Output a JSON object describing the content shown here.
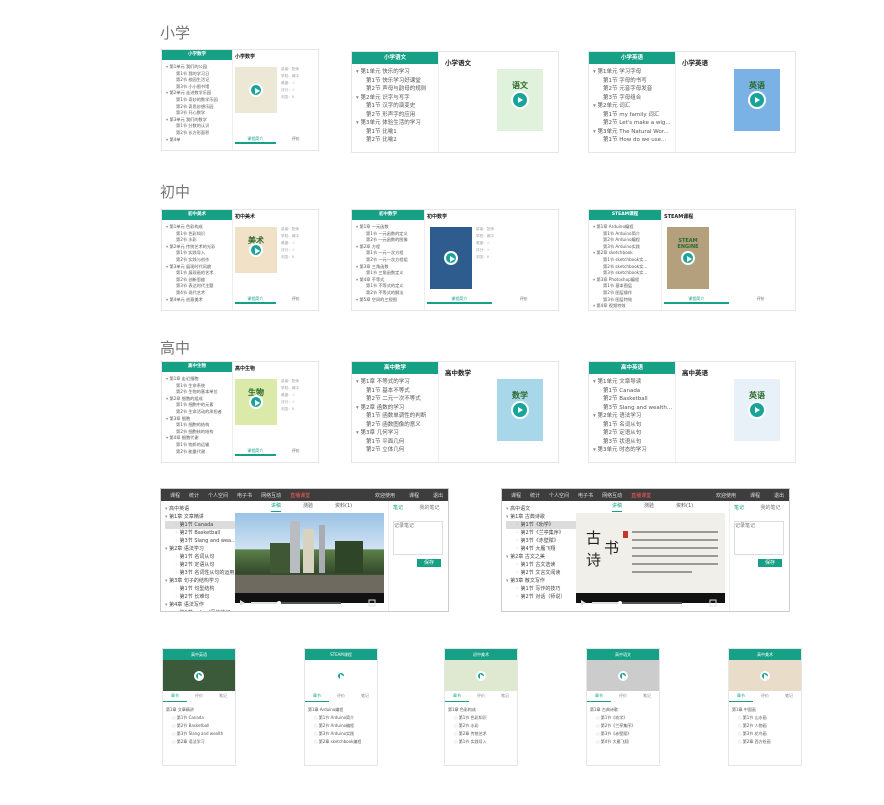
{
  "sections": {
    "primary": "小学",
    "middle": "初中",
    "high": "高中"
  },
  "cards": [
    {
      "title": "小学数学",
      "items": [
        {
          "t": "第1单元 我们的公园",
          "c": 1
        },
        {
          "t": "第1节 我的学习日",
          "s": 1
        },
        {
          "t": "第2节 校园生活记",
          "s": 1
        },
        {
          "t": "第3节 小小图书馆",
          "s": 1
        },
        {
          "t": "第2单元 走进数学乐园",
          "c": 1
        },
        {
          "t": "第1节 奇妙的数学乐园",
          "s": 1
        },
        {
          "t": "第2节 奇思妙想乐园",
          "s": 1
        },
        {
          "t": "第3节 开心数学",
          "s": 1
        },
        {
          "t": "第3单元 我们的数学",
          "c": 1
        },
        {
          "t": "第1节 分数的认识",
          "s": 1
        },
        {
          "t": "第2节 长方形面积",
          "s": 1
        },
        {
          "t": "第4单",
          "c": 1
        }
      ],
      "meta": [
        "讲者：张师",
        "学校：城中",
        "难度：☆",
        "评分：☆",
        "浏览：0"
      ],
      "tabs": [
        "课程简介",
        "评价"
      ],
      "cover": "#ede7d6",
      "coverText": ""
    },
    {
      "title": "小学语文",
      "items": [
        {
          "t": "第1单元 快乐的学习",
          "c": 1
        },
        {
          "t": "第1节 快乐学习好课堂",
          "s": 1
        },
        {
          "t": "第2节 声母与韵母的规则",
          "s": 1
        },
        {
          "t": "第2单元 识字与写字",
          "c": 1
        },
        {
          "t": "第1节 汉字的演变史",
          "s": 1
        },
        {
          "t": "第2节 形声字的应用",
          "s": 1
        },
        {
          "t": "第3单元 体验生活的学习",
          "c": 1
        },
        {
          "t": "第1节 比喻1",
          "s": 1
        },
        {
          "t": "第2节 比喻2",
          "s": 1
        }
      ],
      "meta": [],
      "tabs": [],
      "cover": "#e0f1dc",
      "coverText": "语文"
    },
    {
      "title": "小学英语",
      "items": [
        {
          "t": "第1单元 学习字母",
          "c": 1
        },
        {
          "t": "第1节 字母的书写",
          "s": 1
        },
        {
          "t": "第2节 元音字母发音",
          "s": 1
        },
        {
          "t": "第3节 字母组合",
          "s": 1
        },
        {
          "t": "第2单元 词汇",
          "c": 1
        },
        {
          "t": "第1节 my family 词汇",
          "s": 1
        },
        {
          "t": "第2节 Let's make a wig...",
          "s": 1
        },
        {
          "t": "第3单元 The Natural Wor...",
          "c": 1
        },
        {
          "t": "第1节 How do we use...",
          "s": 1
        }
      ],
      "meta": [],
      "tabs": [],
      "cover": "#7bb2e6",
      "coverText": "英语"
    },
    {
      "title": "初中美术",
      "items": [
        {
          "t": "第1单元 色彩构成",
          "c": 1
        },
        {
          "t": "第1节 色彩知识",
          "s": 1
        },
        {
          "t": "第2节 水彩",
          "s": 1
        },
        {
          "t": "第2单元 传统艺术的光彩",
          "c": 1
        },
        {
          "t": "第1节 实践导入",
          "s": 1
        },
        {
          "t": "第2节 实践与创作",
          "s": 1
        },
        {
          "t": "第3单元 展现时代风貌",
          "c": 1
        },
        {
          "t": "第1节 展现画的艺术",
          "s": 1
        },
        {
          "t": "第2节 创新思维",
          "s": 1
        },
        {
          "t": "第3节 表达时代主题",
          "s": 1
        },
        {
          "t": "第4节 现代艺术",
          "s": 1
        },
        {
          "t": "第4单元 创意美术",
          "c": 1
        }
      ],
      "meta": [
        "讲者：张师",
        "学校：城中",
        "难度：☆",
        "评分：☆",
        "浏览：0"
      ],
      "tabs": [
        "课程简介",
        "评价"
      ],
      "cover": "#f0e1c7",
      "coverText": "美术"
    },
    {
      "title": "初中数学",
      "items": [
        {
          "t": "第1章 一元函数",
          "c": 1
        },
        {
          "t": "第1节 一元函数的定义",
          "s": 1
        },
        {
          "t": "第2节 一元函数的图像",
          "s": 1
        },
        {
          "t": "第2章 方程",
          "c": 1
        },
        {
          "t": "第1节 一元一次方程",
          "s": 1
        },
        {
          "t": "第2节 一元一次方程组",
          "s": 1
        },
        {
          "t": "第3章 三角函数",
          "c": 1
        },
        {
          "t": "第1节 三角函数定义",
          "s": 1
        },
        {
          "t": "第4章 不等式",
          "c": 1
        },
        {
          "t": "第1节 不等式的定义",
          "s": 1
        },
        {
          "t": "第2节 不等式的解法",
          "s": 1
        },
        {
          "t": "第5章 空间的三视图",
          "c": 1
        }
      ],
      "meta": [
        "讲者：张师",
        "学校：城中",
        "难度：☆",
        "评分：☆",
        "浏览：0"
      ],
      "tabs": [
        "课程简介",
        "评价"
      ],
      "cover": "#2f5c8f",
      "coverText": ""
    },
    {
      "title": "STEAM课程",
      "items": [
        {
          "t": "第1章 Arduino编程",
          "c": 1
        },
        {
          "t": "第1节 Arduino简介",
          "s": 1
        },
        {
          "t": "第2节 Arduino编程",
          "s": 1
        },
        {
          "t": "第3节 Arduino实践",
          "s": 1
        },
        {
          "t": "第2章 sketchbook",
          "c": 1
        },
        {
          "t": "第1节 sketchbook实...",
          "s": 1
        },
        {
          "t": "第2节 sketchbook实...",
          "s": 1
        },
        {
          "t": "第3节 sketchbook实...",
          "s": 1
        },
        {
          "t": "第3章 Photoshop编程",
          "c": 1
        },
        {
          "t": "第1节 基本图层",
          "s": 1
        },
        {
          "t": "第2节 图层操作",
          "s": 1
        },
        {
          "t": "第3节 图层特效",
          "s": 1
        },
        {
          "t": "第4章 视频特效",
          "c": 1
        }
      ],
      "meta": [],
      "tabs": [
        "课程简介",
        "评价"
      ],
      "cover": "#b4a07c",
      "coverText": "STEAM ENGINE"
    },
    {
      "title": "高中生物",
      "items": [
        {
          "t": "第1章 走近细胞",
          "c": 1
        },
        {
          "t": "第1节 生命系统",
          "s": 1
        },
        {
          "t": "第2节 生物的基本单位",
          "s": 1
        },
        {
          "t": "第2章 细胞的组成",
          "c": 1
        },
        {
          "t": "第1节 细胞中的元素",
          "s": 1
        },
        {
          "t": "第2节 生命活动的承担者",
          "s": 1
        },
        {
          "t": "第3章 细胞",
          "c": 1
        },
        {
          "t": "第1节 细胞的结构",
          "s": 1
        },
        {
          "t": "第2节 细胞核的结构",
          "s": 1
        },
        {
          "t": "第4章 细胞代谢",
          "c": 1
        },
        {
          "t": "第1节 物质的运输",
          "s": 1
        },
        {
          "t": "第2节 能量代谢",
          "s": 1
        }
      ],
      "meta": [
        "讲者：张师",
        "学校：城中",
        "难度：☆",
        "评分：☆",
        "浏览：0"
      ],
      "tabs": [
        "课程简介",
        "评价"
      ],
      "cover": "#dbe9a9",
      "coverText": "生物"
    },
    {
      "title": "高中数学",
      "items": [
        {
          "t": "第1章 不等式的学习",
          "c": 1
        },
        {
          "t": "第1节 基本不等式",
          "s": 1
        },
        {
          "t": "第2节 二元一次不等式",
          "s": 1
        },
        {
          "t": "第2章 函数的学习",
          "c": 1
        },
        {
          "t": "第1节 函数单调性的判断",
          "s": 1
        },
        {
          "t": "第2节 函数图像的意义",
          "s": 1
        },
        {
          "t": "第3章 几何学习",
          "c": 1
        },
        {
          "t": "第1节 平面几何",
          "s": 1
        },
        {
          "t": "第2节 立体几何",
          "s": 1
        }
      ],
      "meta": [],
      "tabs": [],
      "cover": "#a9d7ea",
      "coverText": "数学"
    },
    {
      "title": "高中英语",
      "items": [
        {
          "t": "第1单元 文章导读",
          "c": 1
        },
        {
          "t": "第1节 Canada",
          "s": 1
        },
        {
          "t": "第2节 Basketball",
          "s": 1
        },
        {
          "t": "第3节 Slang and wealth...",
          "s": 1
        },
        {
          "t": "第2单元 语法学习",
          "c": 1
        },
        {
          "t": "第1节 名词从句",
          "s": 1
        },
        {
          "t": "第2节 定语从句",
          "s": 1
        },
        {
          "t": "第3节 状语从句",
          "s": 1
        },
        {
          "t": "第3单元 时态的学习",
          "c": 1
        }
      ],
      "meta": [],
      "tabs": [],
      "cover": "#e8f1f7",
      "coverText": "英语"
    }
  ],
  "player_nav": [
    "课程",
    "统计",
    "个人空间",
    "电子书",
    "网络互动",
    "直播课堂"
  ],
  "player_nav_right": [
    "欢迎使用",
    "课程",
    "退出"
  ],
  "players": [
    {
      "items": [
        {
          "t": "高中英语",
          "c": 1
        },
        {
          "t": "第1章 文章精讲",
          "c": 1
        },
        {
          "t": "第1节 Canada",
          "s": 1,
          "sel": 1
        },
        {
          "t": "第2节 Basketball",
          "s": 1
        },
        {
          "t": "第3节 Slang and wea...",
          "s": 1
        },
        {
          "t": "第2章 语法学习",
          "c": 1
        },
        {
          "t": "第1节 名词从句",
          "s": 1
        },
        {
          "t": "第2节 定语从句",
          "s": 1
        },
        {
          "t": "第3节 名词性从句的运用...",
          "s": 1
        },
        {
          "t": "第3章 句子的结构学习",
          "c": 1
        },
        {
          "t": "第1节 句型结构",
          "s": 1
        },
        {
          "t": "第2节 长难句",
          "s": 1
        },
        {
          "t": "第4章 语法写作",
          "c": 1
        },
        {
          "t": "第1节 school写作练习",
          "s": 1
        }
      ],
      "tabs": [
        "讲稿",
        "测验",
        "资料(1)"
      ],
      "note": [
        "笔记",
        "我的笔记"
      ],
      "note_ph": "记录笔记",
      "save": "保存",
      "kind": "city"
    },
    {
      "items": [
        {
          "t": "高中语文",
          "c": 1
        },
        {
          "t": "第1章 古典诗歌",
          "c": 1
        },
        {
          "t": "第1节《劝学》",
          "s": 1,
          "sel": 1
        },
        {
          "t": "第2节《兰亭集序》",
          "s": 1
        },
        {
          "t": "第3节《赤壁赋》",
          "s": 1
        },
        {
          "t": "第4节 大雁飞翔",
          "s": 1
        },
        {
          "t": "第2章 古文之美",
          "c": 1
        },
        {
          "t": "第1节 古文选读",
          "s": 1
        },
        {
          "t": "第2节 文言文阅读",
          "s": 1
        },
        {
          "t": "第3章 散文写作",
          "c": 1
        },
        {
          "t": "第1节 写作的技巧",
          "s": 1
        },
        {
          "t": "第2节 对话（师说）",
          "s": 1
        }
      ],
      "tabs": [
        "讲稿",
        "测验",
        "资料(1)"
      ],
      "note": [
        "笔记",
        "我的笔记"
      ],
      "note_ph": "记录笔记",
      "save": "保存",
      "kind": "poem"
    }
  ],
  "phones": [
    {
      "title": "高中英语",
      "tabs": [
        "章节",
        "评价",
        "笔记"
      ],
      "items": [
        "第1章 文章精讲",
        "第1节 Canada",
        "第2节 Basketball",
        "第3节 Slang and wealth",
        "第2章 语法学习"
      ],
      "bg": "#3a5a3a"
    },
    {
      "title": "STEAM课程",
      "tabs": [
        "章节",
        "评价",
        "笔记"
      ],
      "items": [
        "第1章 Arduino编程",
        "第1节 Arduino简介",
        "第2节 Arduino编程",
        "第3节 Arduino实践",
        "第2章 sketchbook编程"
      ],
      "bg": "#ffffff"
    },
    {
      "title": "初中美术",
      "tabs": [
        "章节",
        "评价",
        "笔记"
      ],
      "items": [
        "第1章 色彩构成",
        "第1节 色彩知识",
        "第2节 水彩",
        "第2章 传统艺术",
        "第1节 实践导入"
      ],
      "bg": "#dfe9d2"
    },
    {
      "title": "高中语文",
      "tabs": [
        "章节",
        "评价",
        "笔记"
      ],
      "items": [
        "第1章 古典诗歌",
        "第1节《劝学》",
        "第2节《兰亭集序》",
        "第3节《赤壁赋》",
        "第4节 大雁飞翔"
      ],
      "bg": "#cccccc"
    },
    {
      "title": "高中美术",
      "tabs": [
        "章节",
        "评价",
        "笔记"
      ],
      "items": [
        "第1章 中国画",
        "第1节 山水画",
        "第2节 人物画",
        "第3节 花鸟画",
        "第2章 西方绘画"
      ],
      "bg": "#e9dcc9"
    }
  ]
}
